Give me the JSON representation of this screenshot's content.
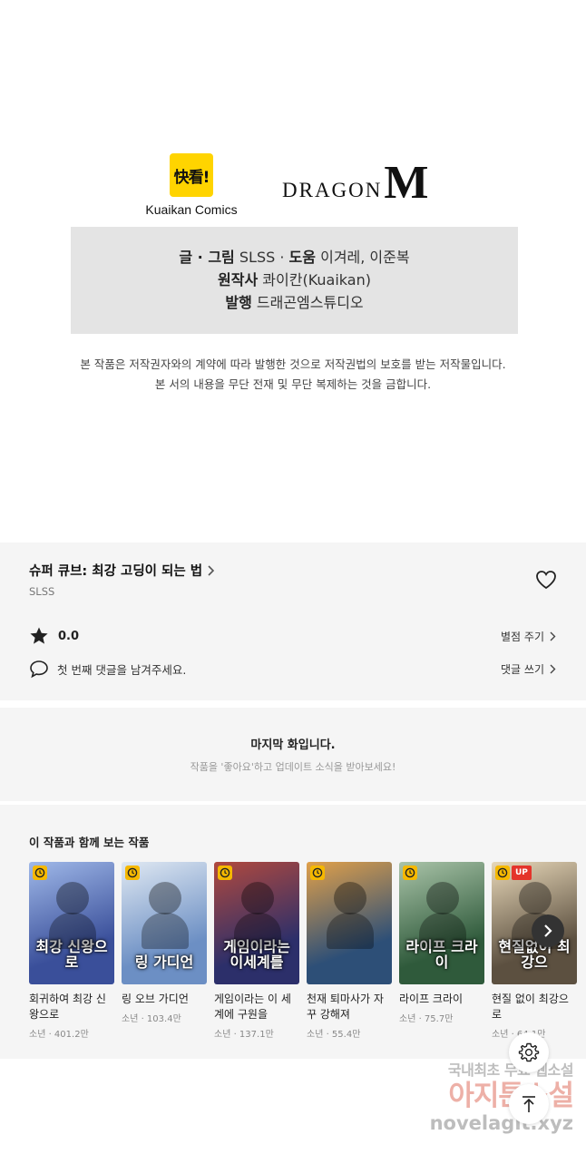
{
  "publishers": {
    "kuaikan_badge": "快看!",
    "kuaikan_name": "Kuaikan Comics",
    "dragon_text": "DRAGON",
    "dragon_m": "M"
  },
  "credits": {
    "line1_label1": "글 · 그림",
    "line1_value1": "SLSS",
    "line1_sep": "·",
    "line1_label2": "도움",
    "line1_value2": "이겨레, 이준복",
    "line2_label": "원작사",
    "line2_value": "콰이칸(Kuaikan)",
    "line3_label": "발행",
    "line3_value": "드래곤엠스튜디오"
  },
  "copyright": {
    "line1": "본 작품은 저작권자와의 계약에 따라 발행한 것으로 저작권법의 보호를 받는 저작물입니다.",
    "line2": "본 서의 내용을 무단 전재 및 무단 복제하는 것을 금합니다."
  },
  "series": {
    "title": "슈퍼 큐브: 최강 고딩이 되는 법",
    "author": "SLSS",
    "rating": "0.0",
    "rate_link": "별점 주기",
    "comment_prompt": "첫 번째 댓글을 남겨주세요.",
    "comment_link": "댓글 쓰기"
  },
  "last_episode": {
    "title": "마지막 화입니다.",
    "subtitle": "작품을 '좋아요'하고 업데이트 소식을 받아보세요!"
  },
  "recommendations": {
    "heading": "이 작품과 함께 보는 작품",
    "items": [
      {
        "name": "회귀하여 최강 신왕으로",
        "meta": "소년 · 401.2만",
        "cover_text": "최강 신왕으로",
        "color1": "#3a4f9a",
        "color2": "#9fb8e8",
        "up": ""
      },
      {
        "name": "링 오브 가디언",
        "meta": "소년 · 103.4만",
        "cover_text": "링 가디언",
        "color1": "#6c8fc4",
        "color2": "#dfe8f2",
        "up": ""
      },
      {
        "name": "게임이라는 이 세계에 구원을",
        "meta": "소년 · 137.1만",
        "cover_text": "게임이라는 이세계를",
        "color1": "#2c2f6a",
        "color2": "#b0493e",
        "up": ""
      },
      {
        "name": "천재 퇴마사가 자꾸 강해져",
        "meta": "소년 · 55.4만",
        "cover_text": "",
        "color1": "#2d4f77",
        "color2": "#e0a04a",
        "up": ""
      },
      {
        "name": "라이프 크라이",
        "meta": "소년 · 75.7만",
        "cover_text": "라이프 크라이",
        "color1": "#2f5a3b",
        "color2": "#a9c3a8",
        "up": ""
      },
      {
        "name": "현질 없이 최강으로",
        "meta": "소년 · 64.1만",
        "cover_text": "현질없이 최강으",
        "color1": "#5c5040",
        "color2": "#e7d7b8",
        "up": "UP"
      }
    ]
  },
  "watermark": {
    "line1": "국내최초 무료 웹소설",
    "line2": "아지툰소설",
    "line3": "novelagit.xyz"
  },
  "colors": {
    "accent_badge": "#f5b800",
    "up_badge": "#e4342b",
    "panel_bg": "#f5f5f5",
    "credit_bg": "#e4e4e4"
  },
  "icons": [
    "heart-icon",
    "star-icon",
    "comment-icon",
    "chevron-right-icon",
    "clock-icon",
    "gear-icon",
    "arrow-up-icon"
  ]
}
